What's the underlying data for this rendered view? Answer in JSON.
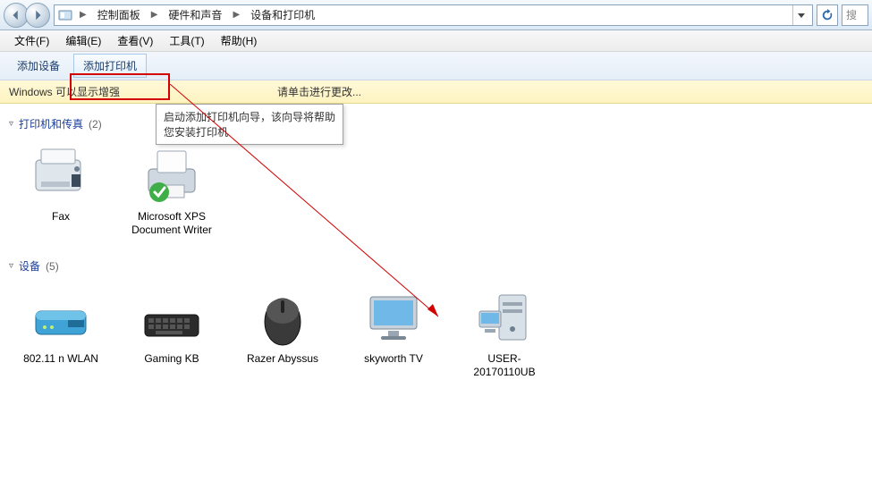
{
  "titlebar": {
    "breadcrumb": {
      "seg1": "控制面板",
      "seg2": "硬件和声音",
      "seg3": "设备和打印机"
    },
    "search_placeholder": "搜"
  },
  "menubar": {
    "file": "文件(F)",
    "edit": "编辑(E)",
    "view": "查看(V)",
    "tools": "工具(T)",
    "help": "帮助(H)"
  },
  "toolbar": {
    "add_device": "添加设备",
    "add_printer": "添加打印机"
  },
  "tooltip": {
    "line1": "启动添加打印机向导，该向导将帮助",
    "line2": "您安装打印机"
  },
  "infobar": {
    "prefix": "Windows 可以显示增强",
    "suffix": "请单击进行更改..."
  },
  "groups": {
    "printers": {
      "title": "打印机和传真",
      "count": "(2)",
      "items": [
        {
          "label": "Fax"
        },
        {
          "label": "Microsoft XPS Document Writer"
        }
      ]
    },
    "devices": {
      "title": "设备",
      "count": "(5)",
      "items": [
        {
          "label": "802.11 n WLAN"
        },
        {
          "label": "Gaming KB"
        },
        {
          "label": "Razer Abyssus"
        },
        {
          "label": "skyworth TV"
        },
        {
          "label": "USER-20170110UB"
        }
      ]
    }
  }
}
